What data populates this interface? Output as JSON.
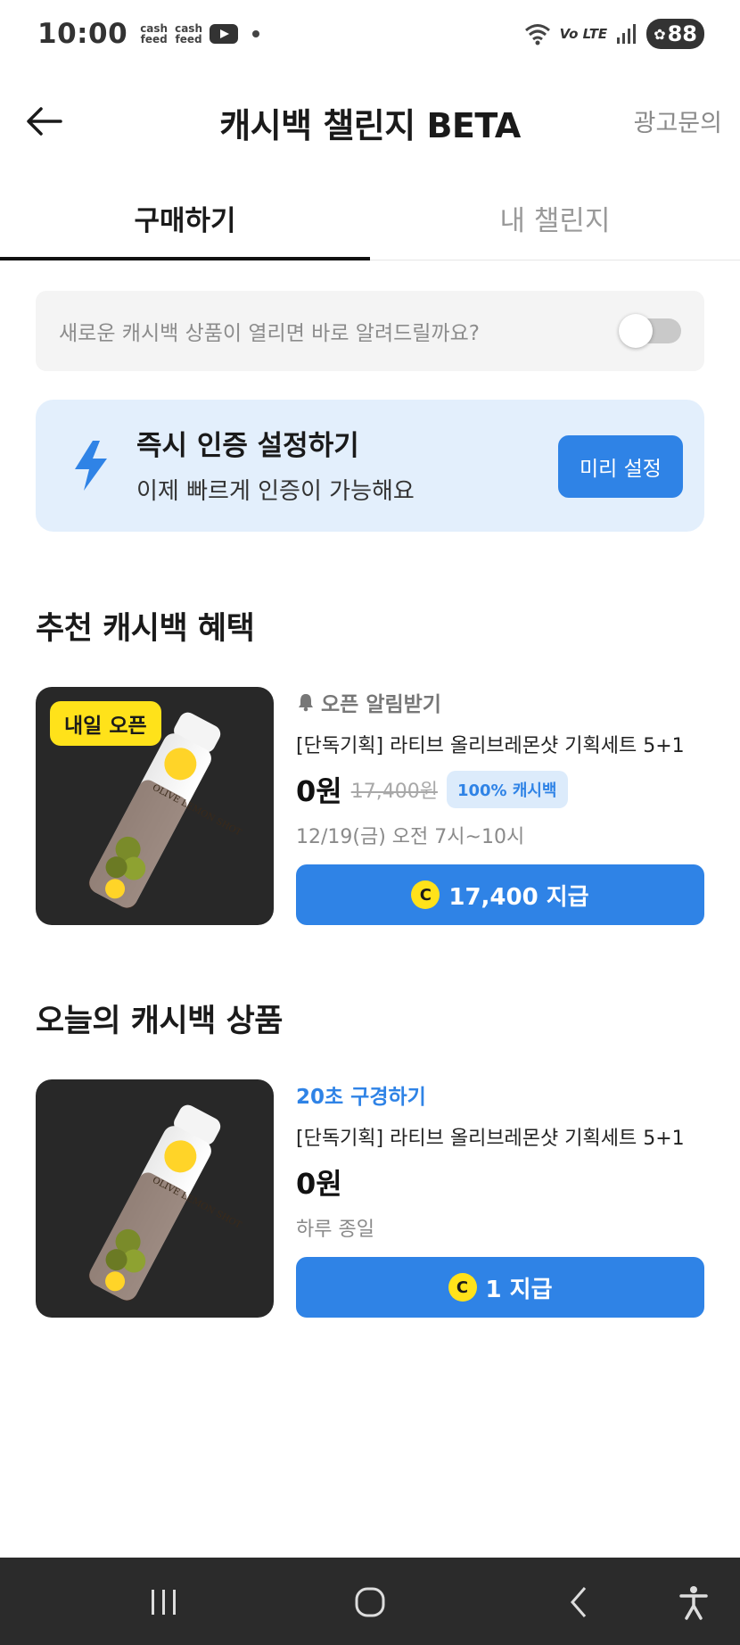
{
  "status_bar": {
    "time": "10:00",
    "app_icons": [
      "cash feed",
      "cash feed"
    ],
    "network": "Vo LTE",
    "battery": "88"
  },
  "header": {
    "title": "캐시백 챌린지 BETA",
    "ad_inquiry": "광고문의"
  },
  "tabs": [
    {
      "label": "구매하기",
      "active": true
    },
    {
      "label": "내 챌린지",
      "active": false
    }
  ],
  "notify": {
    "text": "새로운 캐시백 상품이 열리면 바로 알려드릴까요?",
    "toggle_on": false
  },
  "auth_banner": {
    "title": "즉시 인증 설정하기",
    "subtitle": "이제 빠르게 인증이 가능해요",
    "button": "미리 설정",
    "icon": "lightning-icon"
  },
  "recommended": {
    "section_title": "추천 캐시백 혜택",
    "item": {
      "badge": "내일 오픈",
      "alert_label": "오픈 알림받기",
      "name": "[단독기획] 라티브 올리브레몬샷 기획세트 5+1",
      "price": "0원",
      "original_price": "17,400원",
      "cashback_badge": "100% 캐시백",
      "schedule": "12/19(금) 오전 7시~10시",
      "pay_label": "17,400 지급",
      "image_label": "OLIVE LEMON SHOT"
    }
  },
  "today": {
    "section_title": "오늘의 캐시백 상품",
    "item": {
      "view_link": "20초 구경하기",
      "name": "[단독기획] 라티브 올리브레몬샷 기획세트 5+1",
      "price": "0원",
      "duration": "하루 종일",
      "pay_label": "1 지급",
      "image_label": "OLIVE LEMON SHOT"
    }
  },
  "coin_symbol": "C",
  "colors": {
    "accent": "#2f83e6",
    "badge_yellow": "#ffe21a",
    "banner_bg": "#e3effc"
  }
}
